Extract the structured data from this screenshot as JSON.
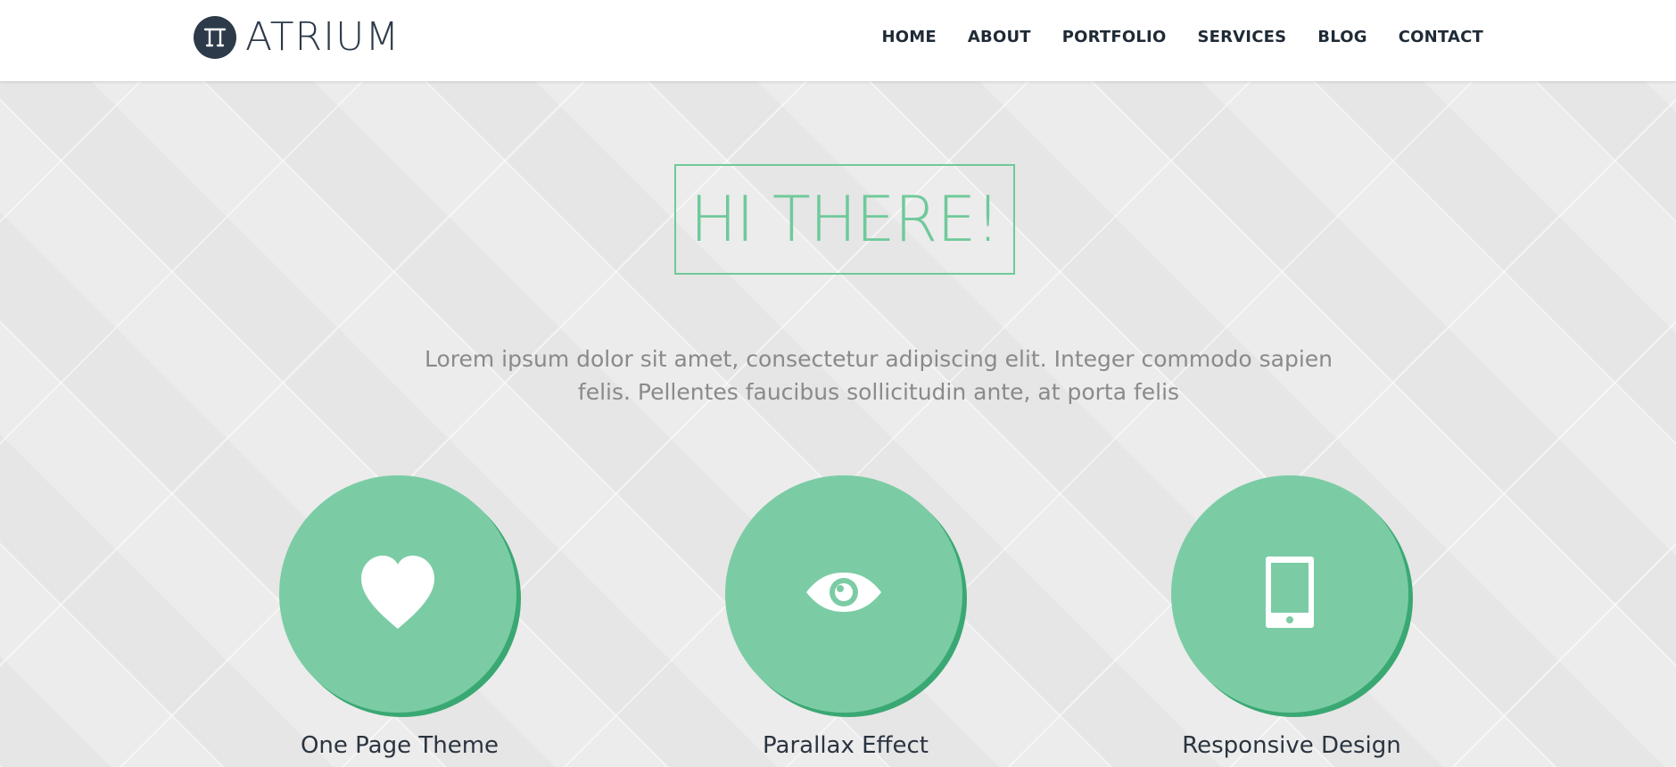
{
  "brand": {
    "name": "ATRIUM",
    "logo_icon": "pi-circle-icon",
    "color": "#2d3a4a"
  },
  "nav": {
    "items": [
      {
        "label": "HOME"
      },
      {
        "label": "ABOUT"
      },
      {
        "label": "PORTFOLIO"
      },
      {
        "label": "SERVICES"
      },
      {
        "label": "BLOG"
      },
      {
        "label": "CONTACT"
      }
    ]
  },
  "hero": {
    "title": "HI THERE!",
    "intro": "Lorem ipsum dolor sit amet, consectetur adipiscing elit. Integer commodo sapien felis. Pellentes faucibus sollicitudin ante, at porta felis",
    "accent_color": "#6fc99a"
  },
  "features": [
    {
      "icon": "heart-icon",
      "title": "One Page Theme"
    },
    {
      "icon": "eye-icon",
      "title": "Parallax Effect"
    },
    {
      "icon": "tablet-icon",
      "title": "Responsive Design"
    }
  ],
  "colors": {
    "circle_fill": "#7bcca5",
    "circle_shadow": "#3aa873",
    "background": "#ebebeb"
  }
}
